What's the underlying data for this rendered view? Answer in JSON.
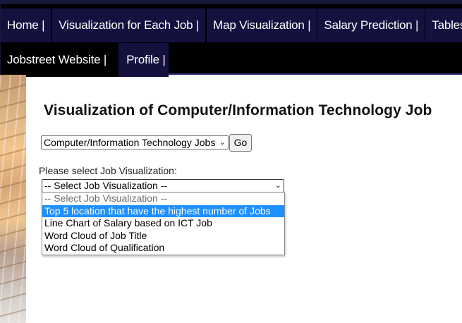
{
  "nav": {
    "items": [
      {
        "label": "Home |"
      },
      {
        "label": "Visualization for Each Job |"
      },
      {
        "label": "Map Visualization |"
      },
      {
        "label": "Salary Prediction |"
      },
      {
        "label": "Tables |"
      },
      {
        "label": "Jobstreet Website |"
      },
      {
        "label": "Profile |"
      }
    ]
  },
  "main": {
    "title": "Visualization of Computer/Information Technology Job",
    "job_select": {
      "value": "Computer/Information Technology Jobs"
    },
    "go_label": "Go",
    "viz_prompt": "Please select Job Visualization:",
    "viz_select": {
      "value": "-- Select Job Visualization --",
      "options": [
        "-- Select Job Visualization --",
        "Top 5 location that have the highest number of Jobs",
        "Line Chart of Salary based on ICT Job",
        "Word Cloud of Job Title",
        "Word Cloud of Qualification"
      ],
      "highlighted_index": 1
    }
  },
  "colors": {
    "nav_item_bg": "#14113f",
    "nav_bar_bg": "#000000",
    "highlight": "#1e90ff"
  }
}
